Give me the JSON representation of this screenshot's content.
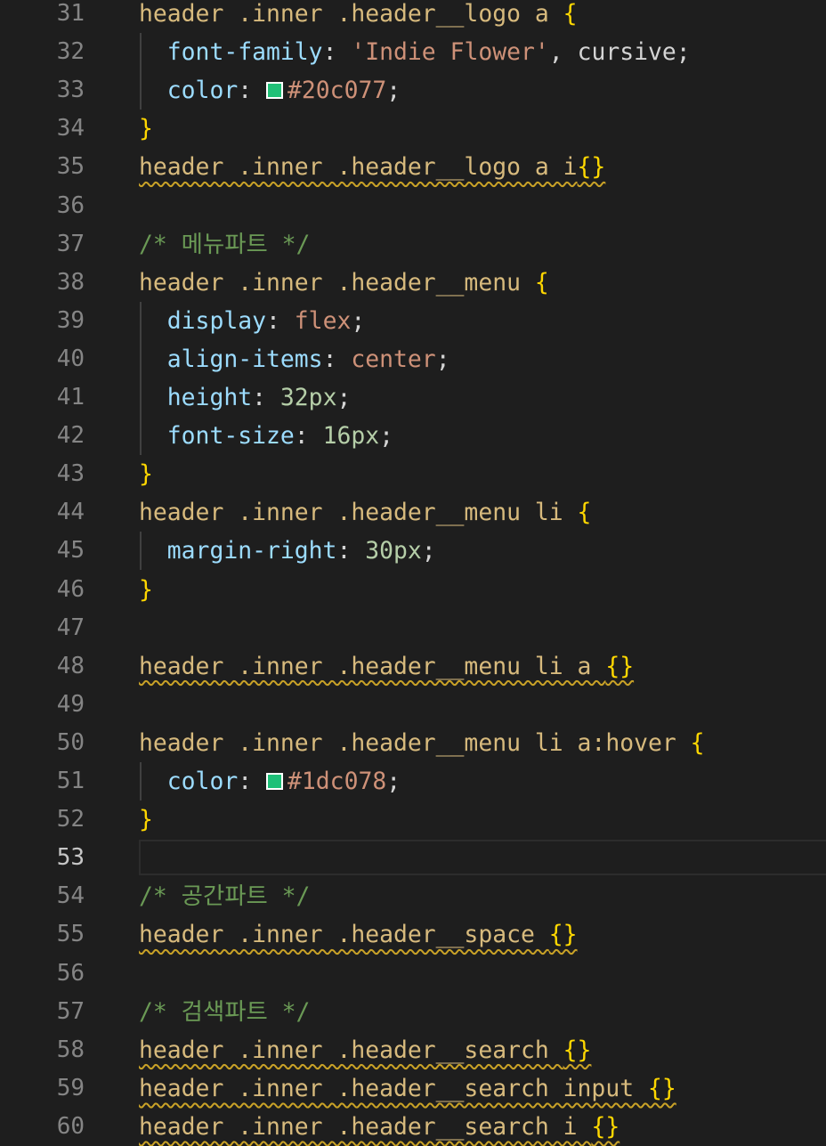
{
  "editor": {
    "current_line": 53,
    "lines": [
      {
        "n": "31",
        "indent": false,
        "squiggle": false,
        "tokens": [
          {
            "t": "header .inner .header__logo a ",
            "c": "sel"
          },
          {
            "t": "{",
            "c": "brace"
          }
        ]
      },
      {
        "n": "32",
        "indent": true,
        "squiggle": false,
        "tokens": [
          {
            "t": "  "
          },
          {
            "t": "font-family",
            "c": "prop"
          },
          {
            "t": ": ",
            "c": "punc"
          },
          {
            "t": "'Indie Flower'",
            "c": "str"
          },
          {
            "t": ", cursive;",
            "c": "punc"
          }
        ]
      },
      {
        "n": "33",
        "indent": true,
        "squiggle": false,
        "tokens": [
          {
            "t": "  "
          },
          {
            "t": "color",
            "c": "prop"
          },
          {
            "t": ": ",
            "c": "punc"
          },
          {
            "swatch": "#20c077"
          },
          {
            "t": "#20c077",
            "c": "str"
          },
          {
            "t": ";",
            "c": "punc"
          }
        ]
      },
      {
        "n": "34",
        "indent": false,
        "squiggle": false,
        "tokens": [
          {
            "t": "}",
            "c": "brace"
          }
        ]
      },
      {
        "n": "35",
        "indent": false,
        "squiggle": true,
        "tokens": [
          {
            "t": "header .inner .header__logo a i",
            "c": "sel"
          },
          {
            "t": "{}",
            "c": "brace"
          }
        ]
      },
      {
        "n": "36",
        "indent": false,
        "squiggle": false,
        "tokens": []
      },
      {
        "n": "37",
        "indent": false,
        "squiggle": false,
        "tokens": [
          {
            "t": "/* 메뉴파트 */",
            "c": "cmt"
          }
        ]
      },
      {
        "n": "38",
        "indent": false,
        "squiggle": false,
        "tokens": [
          {
            "t": "header .inner .header__menu ",
            "c": "sel"
          },
          {
            "t": "{",
            "c": "brace"
          }
        ]
      },
      {
        "n": "39",
        "indent": true,
        "squiggle": false,
        "tokens": [
          {
            "t": "  "
          },
          {
            "t": "display",
            "c": "prop"
          },
          {
            "t": ": ",
            "c": "punc"
          },
          {
            "t": "flex",
            "c": "str"
          },
          {
            "t": ";",
            "c": "punc"
          }
        ]
      },
      {
        "n": "40",
        "indent": true,
        "squiggle": false,
        "tokens": [
          {
            "t": "  "
          },
          {
            "t": "align-items",
            "c": "prop"
          },
          {
            "t": ": ",
            "c": "punc"
          },
          {
            "t": "center",
            "c": "str"
          },
          {
            "t": ";",
            "c": "punc"
          }
        ]
      },
      {
        "n": "41",
        "indent": true,
        "squiggle": false,
        "tokens": [
          {
            "t": "  "
          },
          {
            "t": "height",
            "c": "prop"
          },
          {
            "t": ": ",
            "c": "punc"
          },
          {
            "t": "32px",
            "c": "num"
          },
          {
            "t": ";",
            "c": "punc"
          }
        ]
      },
      {
        "n": "42",
        "indent": true,
        "squiggle": false,
        "tokens": [
          {
            "t": "  "
          },
          {
            "t": "font-size",
            "c": "prop"
          },
          {
            "t": ": ",
            "c": "punc"
          },
          {
            "t": "16px",
            "c": "num"
          },
          {
            "t": ";",
            "c": "punc"
          }
        ]
      },
      {
        "n": "43",
        "indent": false,
        "squiggle": false,
        "tokens": [
          {
            "t": "}",
            "c": "brace"
          }
        ]
      },
      {
        "n": "44",
        "indent": false,
        "squiggle": false,
        "tokens": [
          {
            "t": "header .inner .header__menu li ",
            "c": "sel"
          },
          {
            "t": "{",
            "c": "brace"
          }
        ]
      },
      {
        "n": "45",
        "indent": true,
        "squiggle": false,
        "tokens": [
          {
            "t": "  "
          },
          {
            "t": "margin-right",
            "c": "prop"
          },
          {
            "t": ": ",
            "c": "punc"
          },
          {
            "t": "30px",
            "c": "num"
          },
          {
            "t": ";",
            "c": "punc"
          }
        ]
      },
      {
        "n": "46",
        "indent": false,
        "squiggle": false,
        "tokens": [
          {
            "t": "}",
            "c": "brace"
          }
        ]
      },
      {
        "n": "47",
        "indent": false,
        "squiggle": false,
        "tokens": []
      },
      {
        "n": "48",
        "indent": false,
        "squiggle": true,
        "tokens": [
          {
            "t": "header .inner .header__menu li a ",
            "c": "sel"
          },
          {
            "t": "{}",
            "c": "brace"
          }
        ]
      },
      {
        "n": "49",
        "indent": false,
        "squiggle": false,
        "tokens": []
      },
      {
        "n": "50",
        "indent": false,
        "squiggle": false,
        "tokens": [
          {
            "t": "header .inner .header__menu li a:hover ",
            "c": "sel"
          },
          {
            "t": "{",
            "c": "brace"
          }
        ]
      },
      {
        "n": "51",
        "indent": true,
        "squiggle": false,
        "tokens": [
          {
            "t": "  "
          },
          {
            "t": "color",
            "c": "prop"
          },
          {
            "t": ": ",
            "c": "punc"
          },
          {
            "swatch": "#1dc078"
          },
          {
            "t": "#1dc078",
            "c": "str"
          },
          {
            "t": ";",
            "c": "punc"
          }
        ]
      },
      {
        "n": "52",
        "indent": false,
        "squiggle": false,
        "tokens": [
          {
            "t": "}",
            "c": "brace"
          }
        ]
      },
      {
        "n": "53",
        "indent": false,
        "squiggle": false,
        "tokens": []
      },
      {
        "n": "54",
        "indent": false,
        "squiggle": false,
        "tokens": [
          {
            "t": "/* 공간파트 */",
            "c": "cmt"
          }
        ]
      },
      {
        "n": "55",
        "indent": false,
        "squiggle": true,
        "tokens": [
          {
            "t": "header .inner .header__space ",
            "c": "sel"
          },
          {
            "t": "{}",
            "c": "brace"
          }
        ]
      },
      {
        "n": "56",
        "indent": false,
        "squiggle": false,
        "tokens": []
      },
      {
        "n": "57",
        "indent": false,
        "squiggle": false,
        "tokens": [
          {
            "t": "/* 검색파트 */",
            "c": "cmt"
          }
        ]
      },
      {
        "n": "58",
        "indent": false,
        "squiggle": true,
        "tokens": [
          {
            "t": "header .inner .header__search ",
            "c": "sel"
          },
          {
            "t": "{}",
            "c": "brace"
          }
        ]
      },
      {
        "n": "59",
        "indent": false,
        "squiggle": true,
        "tokens": [
          {
            "t": "header .inner .header__search input ",
            "c": "sel"
          },
          {
            "t": "{}",
            "c": "brace"
          }
        ]
      },
      {
        "n": "60",
        "indent": false,
        "squiggle": true,
        "tokens": [
          {
            "t": "header .inner .header__search i ",
            "c": "sel"
          },
          {
            "t": "{}",
            "c": "brace"
          }
        ]
      }
    ]
  },
  "colors": {
    "background": "#1e1e1e",
    "line_number": "#858585",
    "selector": "#d7ba7d",
    "brace": "#ffd700",
    "property": "#9cdcfe",
    "string": "#ce9178",
    "number": "#b5cea8",
    "comment": "#6a9955",
    "warning_squiggle": "#c9a227"
  }
}
